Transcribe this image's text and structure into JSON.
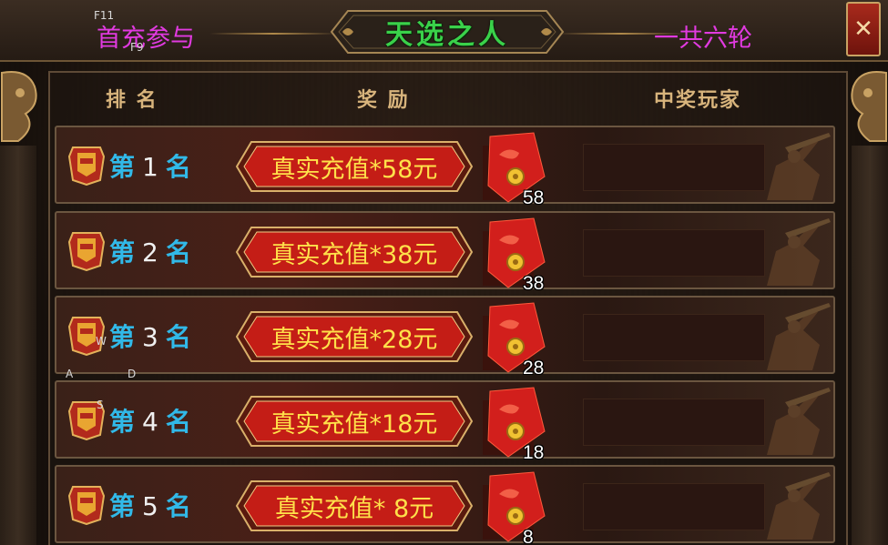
{
  "window": {
    "title": "天选之人",
    "left_notice": "首充参与",
    "right_notice": "一共六轮",
    "close_label": "✕"
  },
  "key_hints": {
    "f11": "F11",
    "f9": "F9",
    "w": "W",
    "a": "A",
    "d": "D",
    "s": "S"
  },
  "columns": {
    "rank": "排 名",
    "reward": "奖 励",
    "winner": "中奖玩家"
  },
  "rank_prefix": "第",
  "rank_suffix": "名",
  "rows": [
    {
      "rank": "1",
      "reward": "真实充值*58元",
      "gift_count": "58"
    },
    {
      "rank": "2",
      "reward": "真实充值*38元",
      "gift_count": "38"
    },
    {
      "rank": "3",
      "reward": "真实充值*28元",
      "gift_count": "28"
    },
    {
      "rank": "4",
      "reward": "真实充值*18元",
      "gift_count": "18"
    },
    {
      "rank": "5",
      "reward": "真实充值* 8元",
      "gift_count": "8"
    }
  ],
  "colors": {
    "title_green": "#3ad14a",
    "notice_magenta": "#e13ae0",
    "rank_blue": "#31b9e8",
    "reward_yellow": "#ffe14a",
    "gift_red": "#d21f1c"
  },
  "icons": [
    "rank-badge-icon",
    "red-envelope-icon",
    "close-icon",
    "dragon-ornament-icon",
    "warrior-silhouette-icon"
  ]
}
